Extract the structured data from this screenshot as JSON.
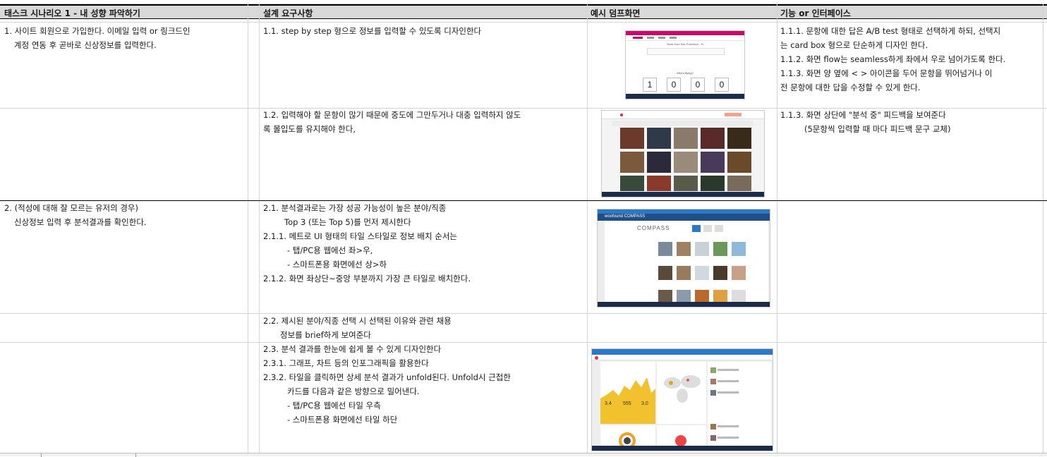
{
  "header": {
    "col1": "태스크 시나리오 1 - 내 성향 파악하기",
    "col2": "설계 요구사항",
    "col3": "예시 덤프화면",
    "col4": "기능 or 인터페이스"
  },
  "rows": {
    "r1": {
      "task": [
        "1. 사이트 회원으로 가입한다. 이메일 입력 or 링크드인",
        "계정 연동 후 곧바로 신상정보를 입력한다."
      ],
      "req": [
        "1.1. step by step 형으로 정보를 입력할 수 있도록 디자인한다"
      ],
      "func": [
        "1.1.1. 문항에 대한 답은 A/B test 형태로 선택하게 하되, 선택지",
        "는 card box 형으로 단순하게 디자인 한다.",
        "1.1.2. 화면 flow는 seamless하게 좌에서 우로 넘어가도록 한다.",
        "1.1.3. 화면 양 옆에 < > 아이콘을 두어 문항을 뛰어넘거나 이",
        "전 문항에 대한 답을 수정할 수 있게 한다."
      ],
      "shot": {
        "title": "Book from San Francisco - N",
        "question": "Who's flying?",
        "counters": [
          "1",
          "0",
          "0",
          "0"
        ]
      }
    },
    "r2": {
      "req": [
        "1.2. 입력해야 할 문항이 많기 때문에 중도에 그만두거나 대충 입력하지 않도",
        "록 몰입도를 유지해야 한다,"
      ],
      "func": [
        "1.1.3. 화면 상단에 \"분석 중\" 피드백을 보여준다",
        "(5문항씩 입력할 때 마다 피드백 문구 교체)"
      ]
    },
    "r3": {
      "task": [
        "2. (적성에 대해 잘 모르는 유저의 경우)",
        "신상정보 입력 후 분석결과를 확인한다."
      ],
      "req": [
        "2.1. 분석결과로는 가장 성공 가능성이 높은 분야/직종",
        "Top 3 (또는 Top 5)를 먼저 제시한다",
        "2.1.1. 메트로 UI 형태의 타일 스타일로 정보 배치 순서는",
        "- 탭/PC용 웹에선 좌>우,",
        "- 스마트폰용 화면에선 상>하",
        "2.1.2. 화면 좌상단~중앙 부분까지 가장 큰 타일로 배치한다."
      ],
      "shot": {
        "brand": "woofound COMPASS",
        "logo": "COMPASS"
      }
    },
    "r4": {
      "req": [
        "2.2. 제시된 분야/직종 선택 시 선택된 이유와 관련 채용",
        "정보를 brief하게 보여준다"
      ]
    },
    "r5": {
      "req": [
        "2.3. 분석 결과를 한눈에 쉽게 볼 수 있게 디자인한다",
        "2.3.1. 그래프, 차트 등의 인포그래픽을 활용한다",
        "2.3.2. 타일을 클릭하면 상세 분석 결과가 unfold된다. Unfold시 근접한",
        "카드를 다음과 같은 방향으로 밀어낸다.",
        "- 탭/PC용 웹에선 타일 우측",
        "- 스마트폰용 화면에선 타일 하단"
      ],
      "shot": {
        "stats": [
          "3.4",
          "555",
          "3.0"
        ]
      }
    }
  },
  "colors": {
    "header_bg": "#d9d9d9",
    "accent_purple": "#c0106c",
    "accent_yellow": "#f2c12e",
    "accent_blue": "#2a78c8"
  }
}
